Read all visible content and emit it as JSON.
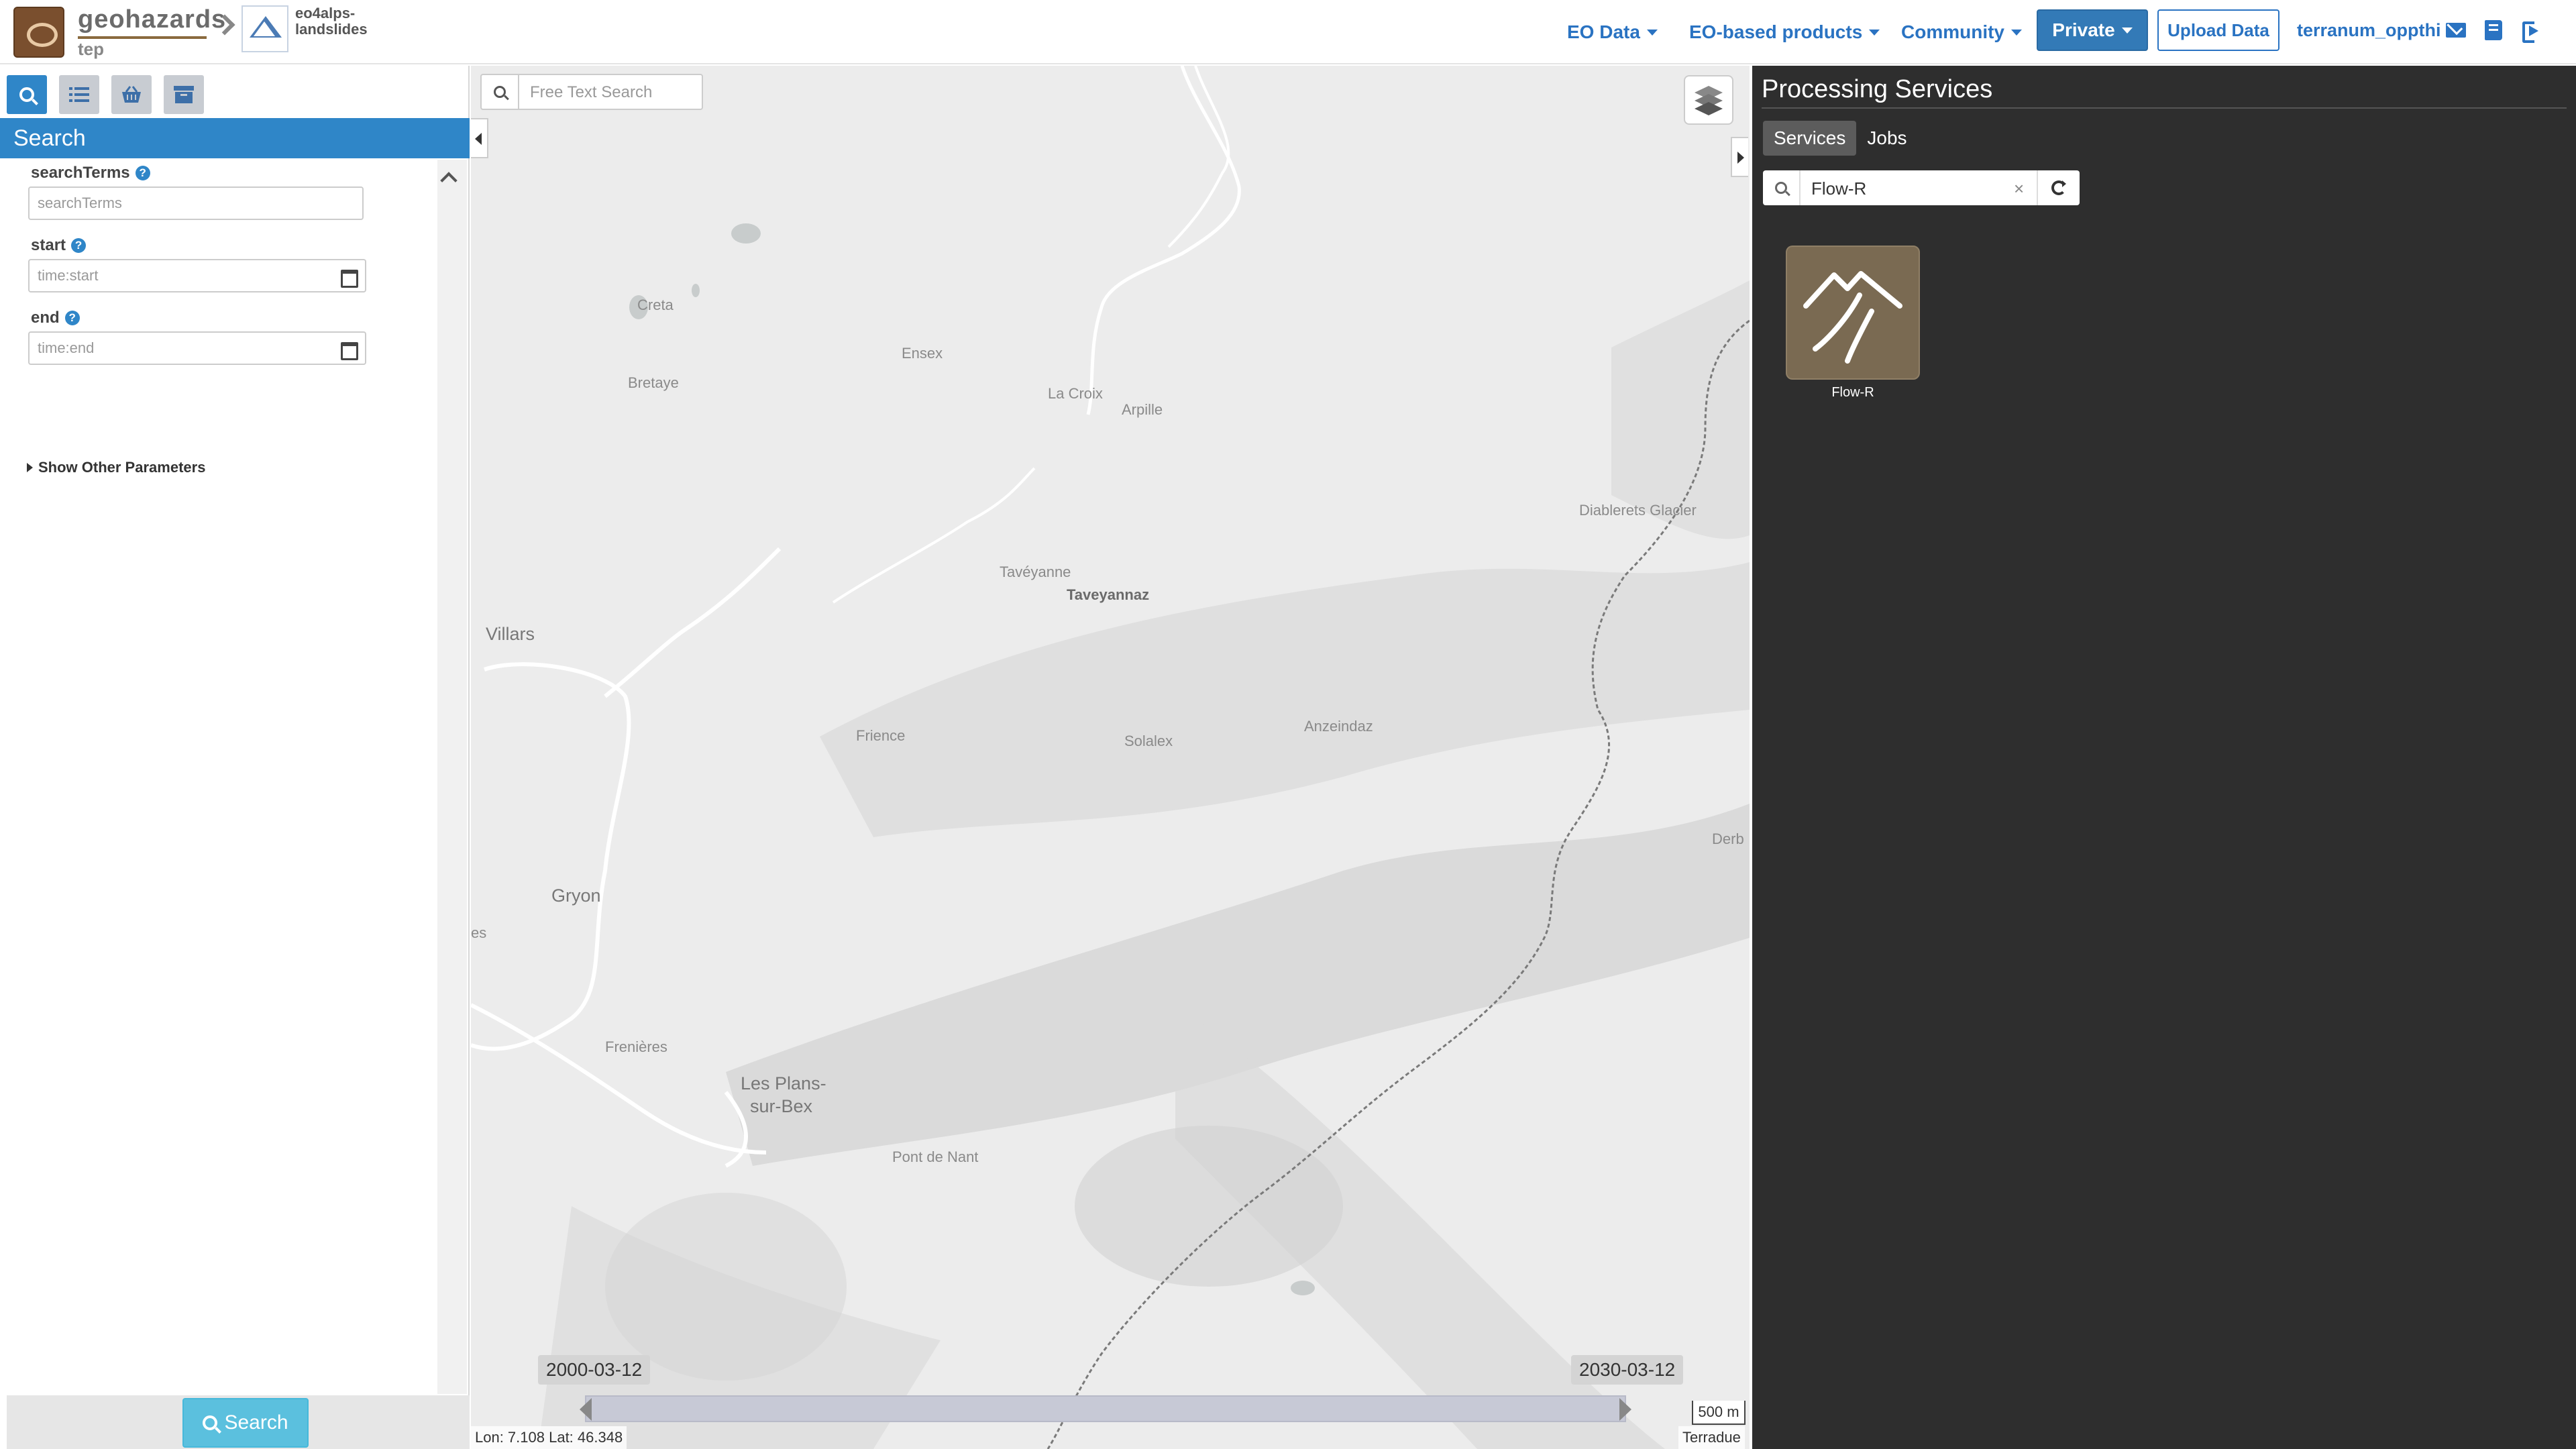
{
  "header": {
    "brand_name": "geohazards",
    "brand_sub": "tep",
    "community_name": "eo4alps-landslides",
    "nav": {
      "eo_data": "EO Data",
      "eo_products": "EO-based products",
      "community": "Community",
      "private": "Private",
      "upload": "Upload Data",
      "username": "terranum_oppthi"
    },
    "icons": [
      "envelope-icon",
      "book-icon",
      "sign-out-icon"
    ],
    "accent_color": "#337ab7"
  },
  "left_panel": {
    "tabs": [
      "search-icon",
      "list-icon",
      "basket-icon",
      "archive-icon"
    ],
    "title": "Search",
    "params": [
      {
        "label": "searchTerms",
        "placeholder": "searchTerms"
      },
      {
        "label": "start",
        "placeholder": "time:start"
      },
      {
        "label": "end",
        "placeholder": "time:end"
      }
    ],
    "other_params": "Show Other Parameters",
    "search_button": "Search"
  },
  "map": {
    "search_placeholder": "Free Text Search",
    "labels": [
      "Creta",
      "Bretaye",
      "Ensex",
      "La Croix",
      "Arpille",
      "Diablerets Glacier",
      "Villars",
      "Tavéyanne",
      "Taveyannaz",
      "Frience",
      "Solalex",
      "Anzeindaz",
      "Gryon",
      "es",
      "Derb",
      "Frenières",
      "Les Plans-",
      "sur-Bex",
      "Pont de Nant"
    ],
    "timeline": {
      "start": "2000-03-12",
      "end": "2030-03-12"
    },
    "scale": "500 m",
    "coords": "Lon: 7.108 Lat: 46.348",
    "attribution": "Terradue"
  },
  "right_panel": {
    "title": "Processing Services",
    "tabs": [
      "Services",
      "Jobs"
    ],
    "search_value": "Flow-R",
    "clear_symbol": "×",
    "services": [
      {
        "name": "Flow-R",
        "icon": "mountain-icon",
        "color": "#7a6a52"
      }
    ],
    "background": "#2e2e2e"
  }
}
